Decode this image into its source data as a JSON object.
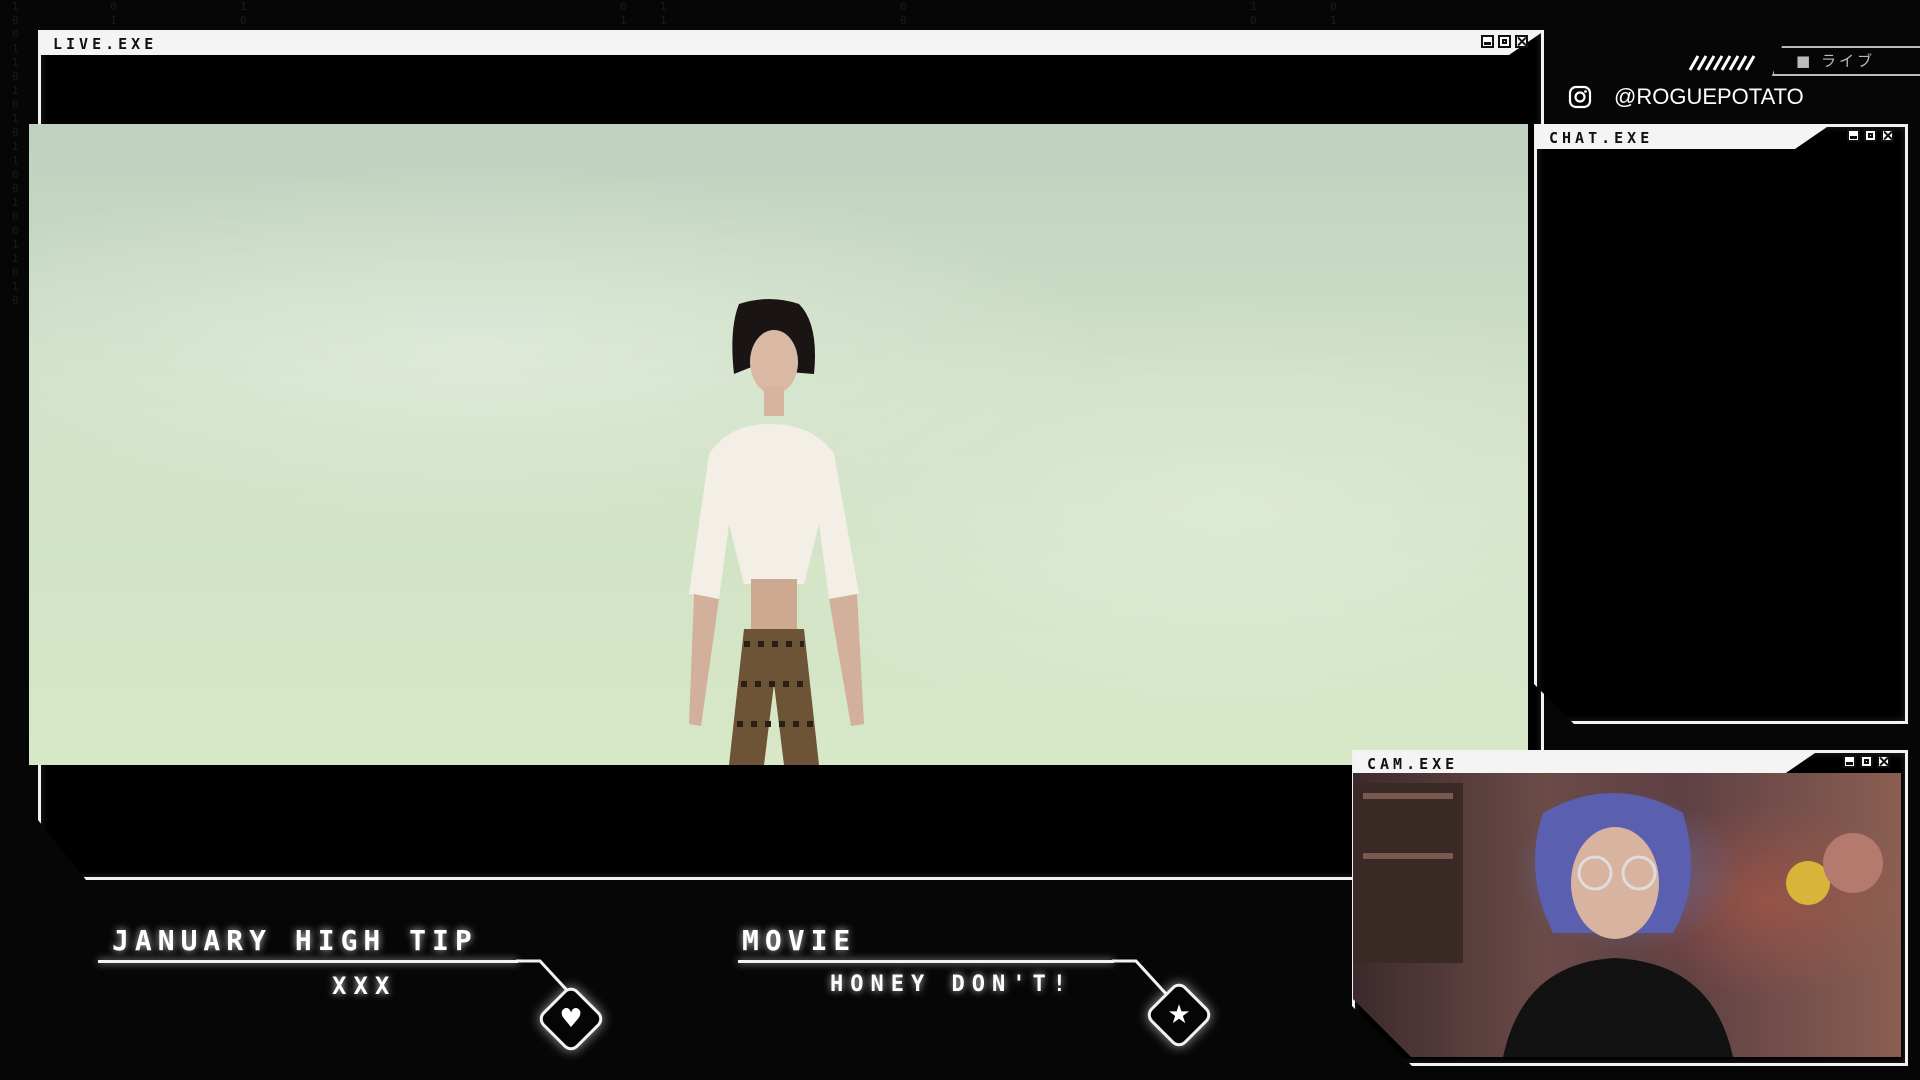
{
  "windows": {
    "live": {
      "title": "LIVE.EXE"
    },
    "chat": {
      "title": "CHAT.EXE"
    },
    "cam": {
      "title": "CAM.EXE"
    }
  },
  "social": {
    "platform_icon": "instagram-icon",
    "handle": "@ROGUEPOTATO"
  },
  "live_badge": {
    "text": "■ ライブ"
  },
  "info_panels": [
    {
      "label": "JANUARY HIGH TIP",
      "value": "XXX",
      "icon": "heart-icon"
    },
    {
      "label": "MOVIE",
      "value": "HONEY DON'T!",
      "icon": "star-icon"
    }
  ],
  "colors": {
    "frame": "#f2f2f2",
    "background": "#060606",
    "accent_red": "#c0392b"
  }
}
